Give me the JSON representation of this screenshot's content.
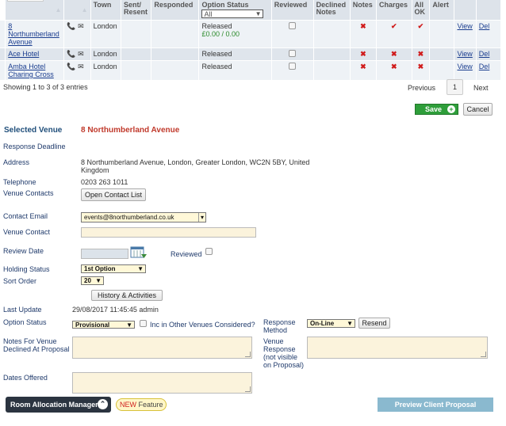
{
  "table": {
    "headers": [
      "Town",
      "Sent/ Resent",
      "Responded",
      "Option Status",
      "Reviewed",
      "Declined Notes",
      "Notes",
      "Charges",
      "All OK",
      "Alert"
    ],
    "filter_value": "All",
    "rows": [
      {
        "venue": "8 Northumberland Avenue",
        "town": "London",
        "status": "Released",
        "amount": "£0.00 / 0.00",
        "notes": "✖",
        "charges": "✔",
        "allok": "✔",
        "view": "View",
        "del": "Del"
      },
      {
        "venue": "Ace Hotel",
        "town": "London",
        "status": "Released",
        "amount": "",
        "notes": "✖",
        "charges": "✖",
        "allok": "✖",
        "view": "View",
        "del": "Del"
      },
      {
        "venue": "Amba Hotel Charing Cross",
        "town": "London",
        "status": "Released",
        "amount": "",
        "notes": "✖",
        "charges": "✖",
        "allok": "✖",
        "view": "View",
        "del": "Del"
      }
    ]
  },
  "pagination": {
    "info": "Showing 1 to 3 of 3 entries",
    "previous": "Previous",
    "page": "1",
    "next": "Next"
  },
  "actions": {
    "save": "Save",
    "cancel": "Cancel"
  },
  "venue": {
    "selected_label": "Selected Venue",
    "selected_value": "8 Northumberland Avenue",
    "deadline_label": "Response Deadline",
    "address_label": "Address",
    "address_value": "8 Northumberland Avenue, London, Greater London, WC2N 5BY, United Kingdom",
    "telephone_label": "Telephone",
    "telephone_value": "0203 263 1011",
    "contacts_label": "Venue Contacts",
    "open_contact_list": "Open Contact List",
    "contact_email_label": "Contact Email",
    "contact_email_value": "events@8northumberland.co.uk",
    "venue_contact_label": "Venue Contact",
    "review_date_label": "Review Date",
    "reviewed_label": "Reviewed",
    "holding_status_label": "Holding Status",
    "holding_status_value": "1st Option",
    "sort_order_label": "Sort Order",
    "sort_order_value": "20",
    "history_button": "History & Activities",
    "last_update_label": "Last Update",
    "last_update_value": "29/08/2017 11:45:45 admin",
    "option_status_label": "Option Status",
    "option_status_value": "Provisional",
    "inc_other_label": "Inc in Other Venues Considered?",
    "response_method_label": "Response Method",
    "response_method_value": "On-Line",
    "resend": "Resend",
    "notes_declined_label": "Notes For Venue Declined At Proposal",
    "venue_response_label": "Venue Response (not visible on Proposal)",
    "dates_offered_label": "Dates Offered"
  },
  "footer": {
    "room_allocation": "Room Allocation Manager",
    "new_badge": "NEW",
    "feature": "Feature",
    "preview": "Preview Client Proposal Document"
  },
  "colors": {
    "accent_red": "#c0392b",
    "save_green": "#2e9e3a",
    "footer_dark": "#2b3440",
    "preview_blue": "#8ab9cf"
  }
}
